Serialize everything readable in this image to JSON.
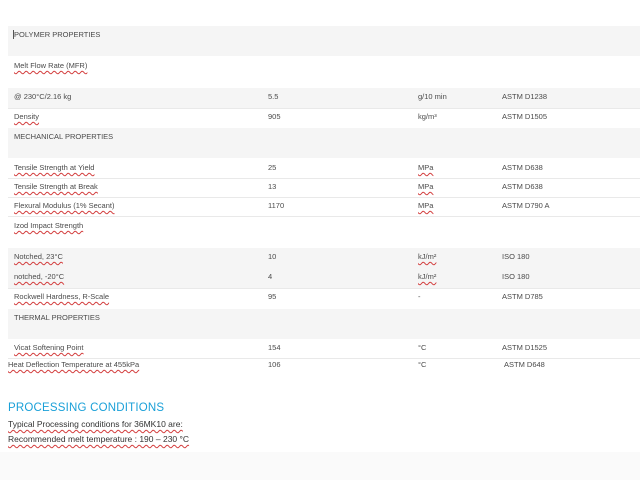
{
  "sections": {
    "polymer": "POLYMER PROPERTIES",
    "mechanical": "MECHANICAL PROPERTIES",
    "thermal": "THERMAL PROPERTIES"
  },
  "polymer_rows": [
    {
      "property": "Melt Flow Rate (MFR)",
      "value": "",
      "unit": "",
      "method": ""
    },
    {
      "property": "@ 230°C/2.16 kg",
      "value": "5.5",
      "unit": "g/10 min",
      "method": "ASTM D1238"
    },
    {
      "property": "Density",
      "value": "905",
      "unit": "kg/m³",
      "method": "ASTM D1505"
    }
  ],
  "mechanical_rows": [
    {
      "property": "Tensile Strength at Yield",
      "value": "25",
      "unit": "MPa",
      "method": "ASTM D638"
    },
    {
      "property": "Tensile Strength at Break",
      "value": "13",
      "unit": "MPa",
      "method": "ASTM D638"
    },
    {
      "property": "Flexural Modulus (1% Secant)",
      "value": "1170",
      "unit": "MPa",
      "method": "ASTM D790 A"
    },
    {
      "property": "Izod Impact Strength",
      "value": "",
      "unit": "",
      "method": ""
    },
    {
      "property": "Notched, 23°C",
      "value": "10",
      "unit": "kJ/m²",
      "method": "ISO 180"
    },
    {
      "property": "notched, -20°C",
      "value": "4",
      "unit": "kJ/m²",
      "method": "ISO 180"
    },
    {
      "property": "Rockwell Hardness, R-Scale",
      "value": "95",
      "unit": "-",
      "method": "ASTM D785"
    }
  ],
  "thermal_rows": [
    {
      "property": "Vicat Softening Point",
      "value": "154",
      "unit": "°C",
      "method": "ASTM D1525"
    },
    {
      "property": "Heat Deflection Temperature at 455kPa",
      "value": "106",
      "unit": "°C",
      "method": "ASTM D648"
    }
  ],
  "processing": {
    "title": "PROCESSING CONDITIONS",
    "line1": "Typical Processing conditions for 36MK10 are:",
    "line2": "Recommended melt temperature : 190 – 230 °C"
  }
}
